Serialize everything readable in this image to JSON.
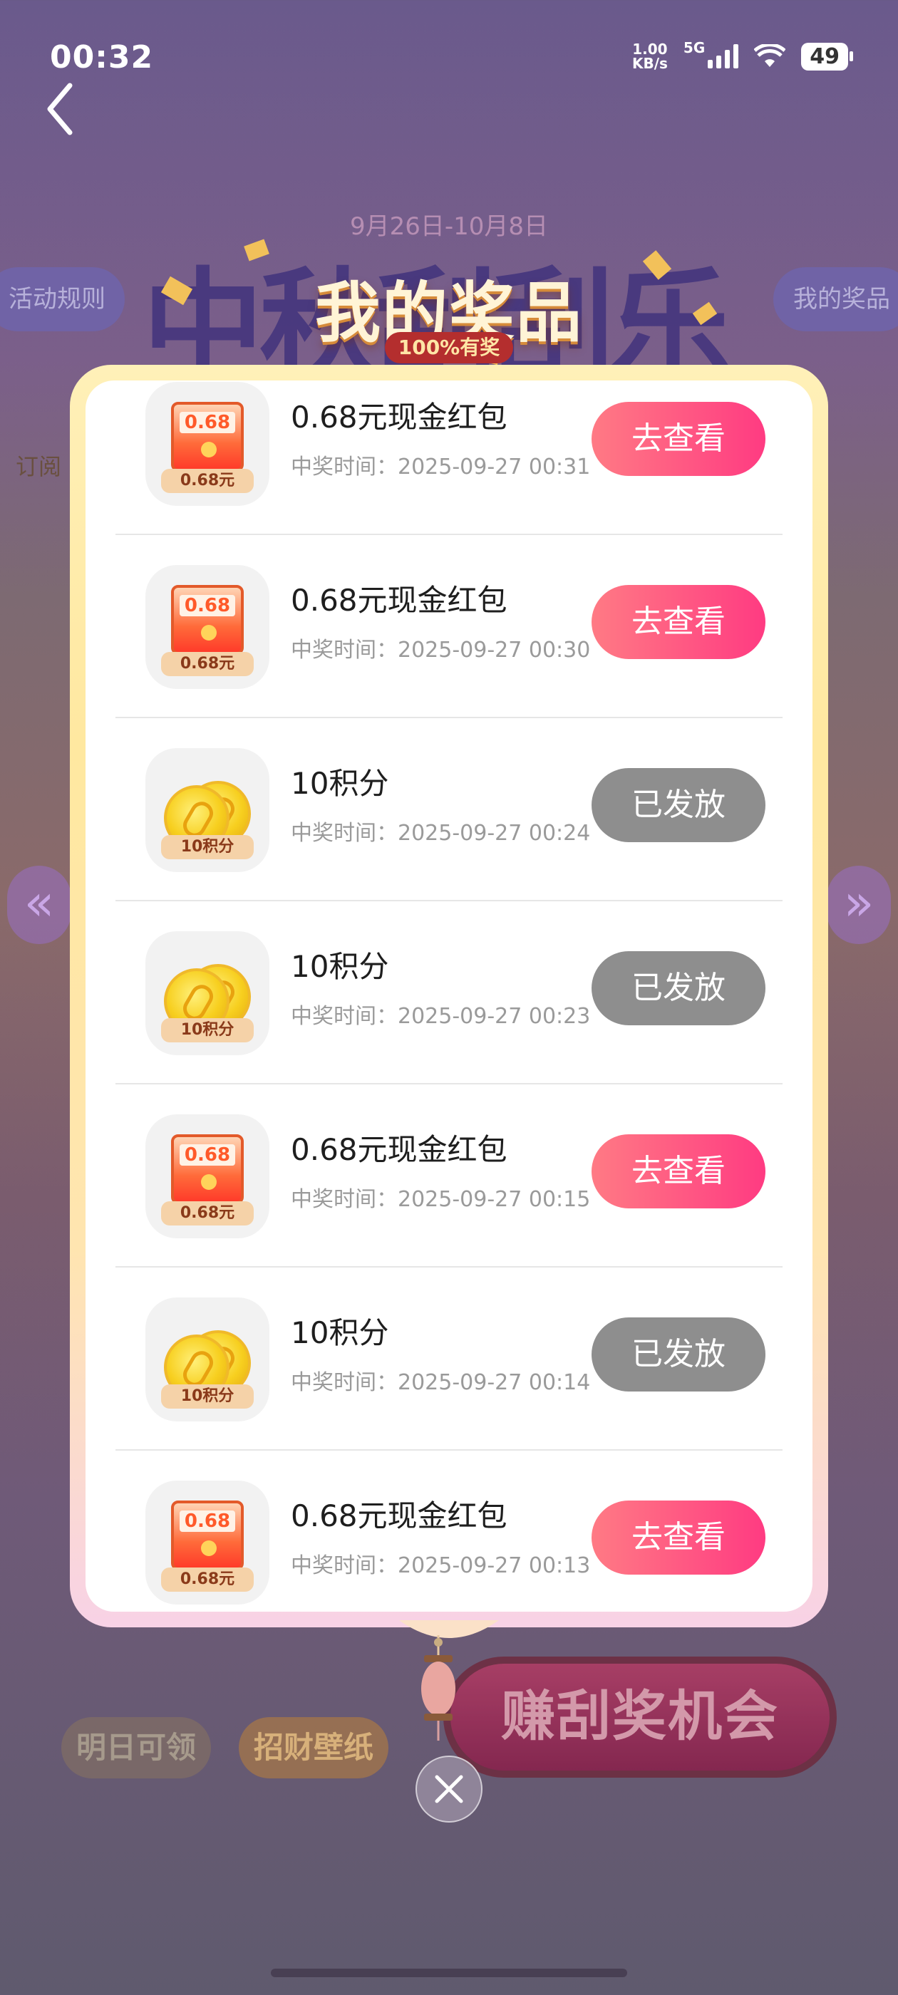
{
  "status_bar": {
    "time": "00:32",
    "net_speed_value": "1.00",
    "net_speed_unit": "KB/s",
    "network": "5G",
    "battery": "49"
  },
  "background": {
    "date_range": "9月26日-10月8日",
    "promo_title": "中秋刮刮乐",
    "rules_button": "活动规则",
    "my_prizes_button": "我的奖品",
    "subscribe_label": "订阅",
    "tomorrow_button": "明日可领",
    "wallpaper_button": "招财壁纸",
    "earn_button": "赚刮奖机会"
  },
  "modal": {
    "title": "我的奖品",
    "badge": "100%有奖",
    "time_prefix": "中奖时间：",
    "items": [
      {
        "name": "0.68元现金红包",
        "time": "中奖时间：2025-09-27 00:31",
        "button": "去查看",
        "type": "cash",
        "thumb_amount": "0.68",
        "thumb_caption": "0.68元"
      },
      {
        "name": "0.68元现金红包",
        "time": "中奖时间：2025-09-27 00:30",
        "button": "去查看",
        "type": "cash",
        "thumb_amount": "0.68",
        "thumb_caption": "0.68元"
      },
      {
        "name": "10积分",
        "time": "中奖时间：2025-09-27 00:24",
        "button": "已发放",
        "type": "points",
        "thumb_caption": "10积分"
      },
      {
        "name": "10积分",
        "time": "中奖时间：2025-09-27 00:23",
        "button": "已发放",
        "type": "points",
        "thumb_caption": "10积分"
      },
      {
        "name": "0.68元现金红包",
        "time": "中奖时间：2025-09-27 00:15",
        "button": "去查看",
        "type": "cash",
        "thumb_amount": "0.68",
        "thumb_caption": "0.68元"
      },
      {
        "name": "10积分",
        "time": "中奖时间：2025-09-27 00:14",
        "button": "已发放",
        "type": "points",
        "thumb_caption": "10积分"
      },
      {
        "name": "0.68元现金红包",
        "time": "中奖时间：2025-09-27 00:13",
        "button": "去查看",
        "type": "cash",
        "thumb_amount": "0.68",
        "thumb_caption": "0.68元"
      }
    ]
  },
  "icons": {
    "back": "chevron-left-icon",
    "close": "close-icon",
    "cash_thumb": "red-envelope-icon",
    "points_thumb": "gold-coin-icon"
  },
  "colors": {
    "view_button": "#ff3b82",
    "issued_button": "#8e8e8e",
    "modal_border": "#ffe8a0"
  }
}
